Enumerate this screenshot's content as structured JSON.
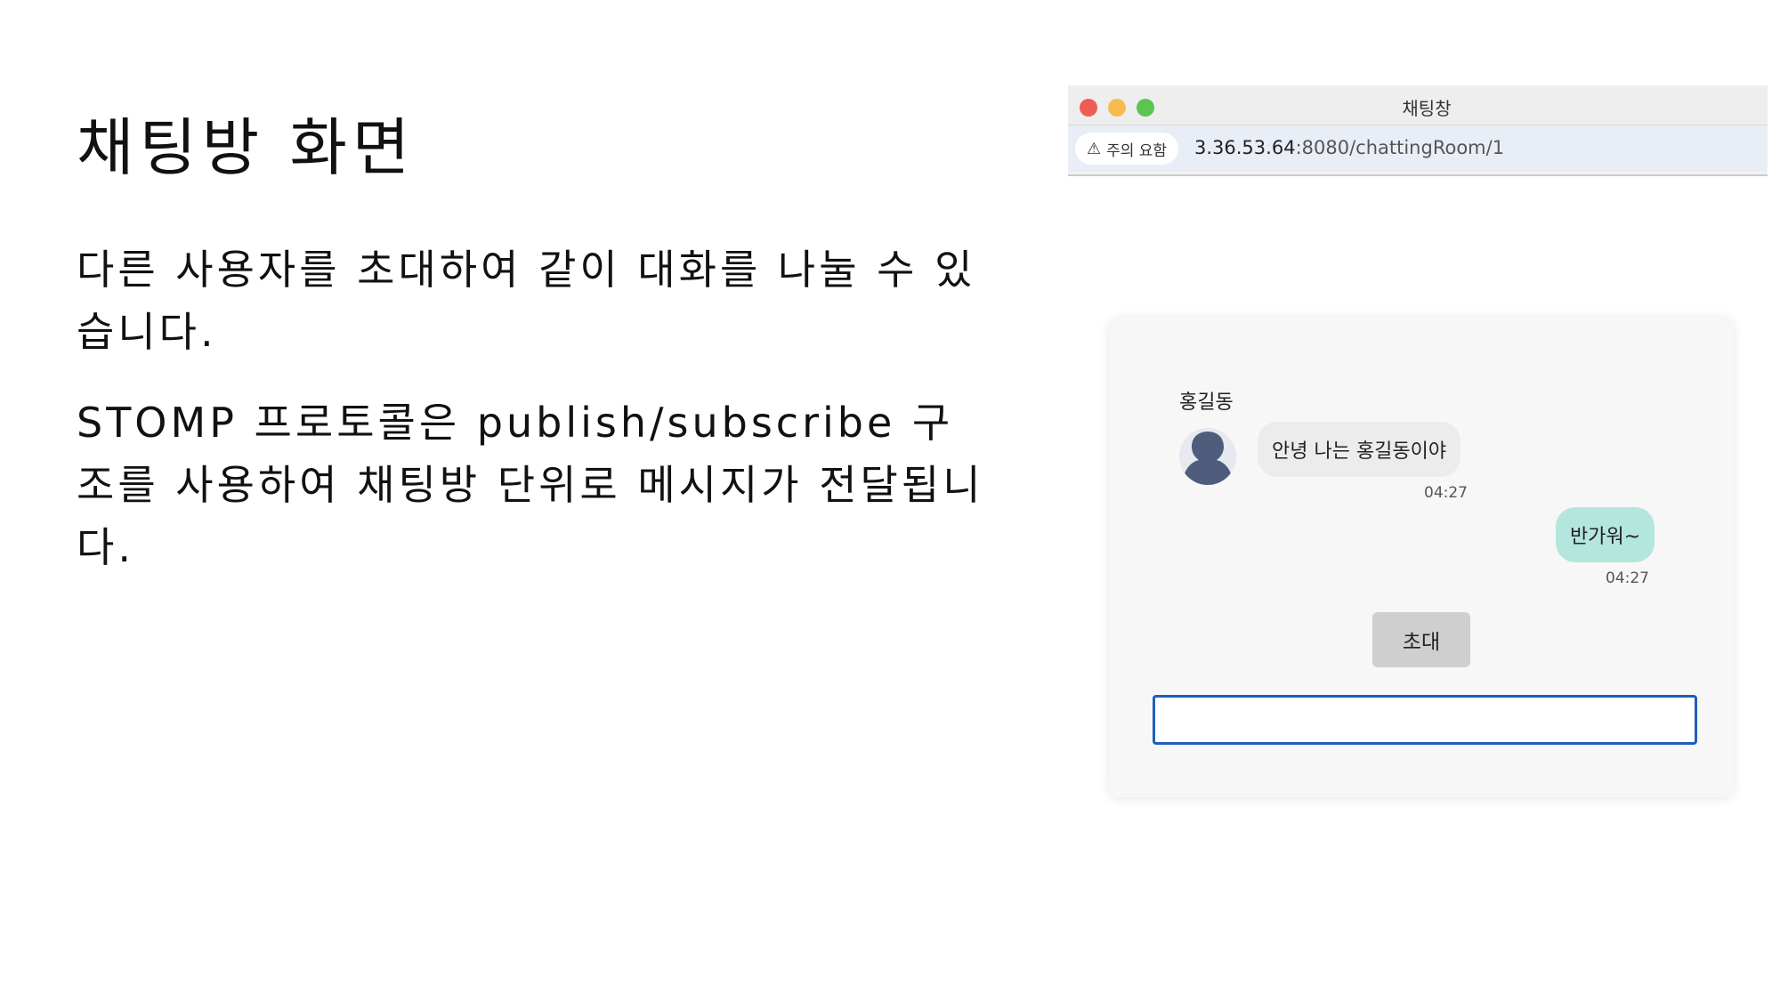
{
  "slide": {
    "title": "채팅방 화면",
    "paragraph1": "다른 사용자를 초대하여 같이 대화를 나눌 수 있습니다.",
    "paragraph2": "STOMP 프로토콜은 publish/subscribe 구조를 사용하여 채팅방 단위로 메시지가 전달됩니다."
  },
  "browser": {
    "window_title": "채팅창",
    "security_label": "주의 요함",
    "security_icon": "warning-triangle-icon",
    "url_host": "3.36.53.64",
    "url_path": ":8080/chattingRoom/1"
  },
  "chat": {
    "messages": [
      {
        "sender": "홍길동",
        "text": "안녕 나는 홍길동이야",
        "time": "04:27",
        "direction": "incoming"
      },
      {
        "sender": "",
        "text": "반가워~",
        "time": "04:27",
        "direction": "outgoing"
      }
    ],
    "invite_label": "초대",
    "input_value": ""
  },
  "colors": {
    "incoming_bubble": "#ececec",
    "outgoing_bubble": "#b3e6dd",
    "input_border": "#1f5fb8",
    "invite_button": "#cfcfcf"
  }
}
